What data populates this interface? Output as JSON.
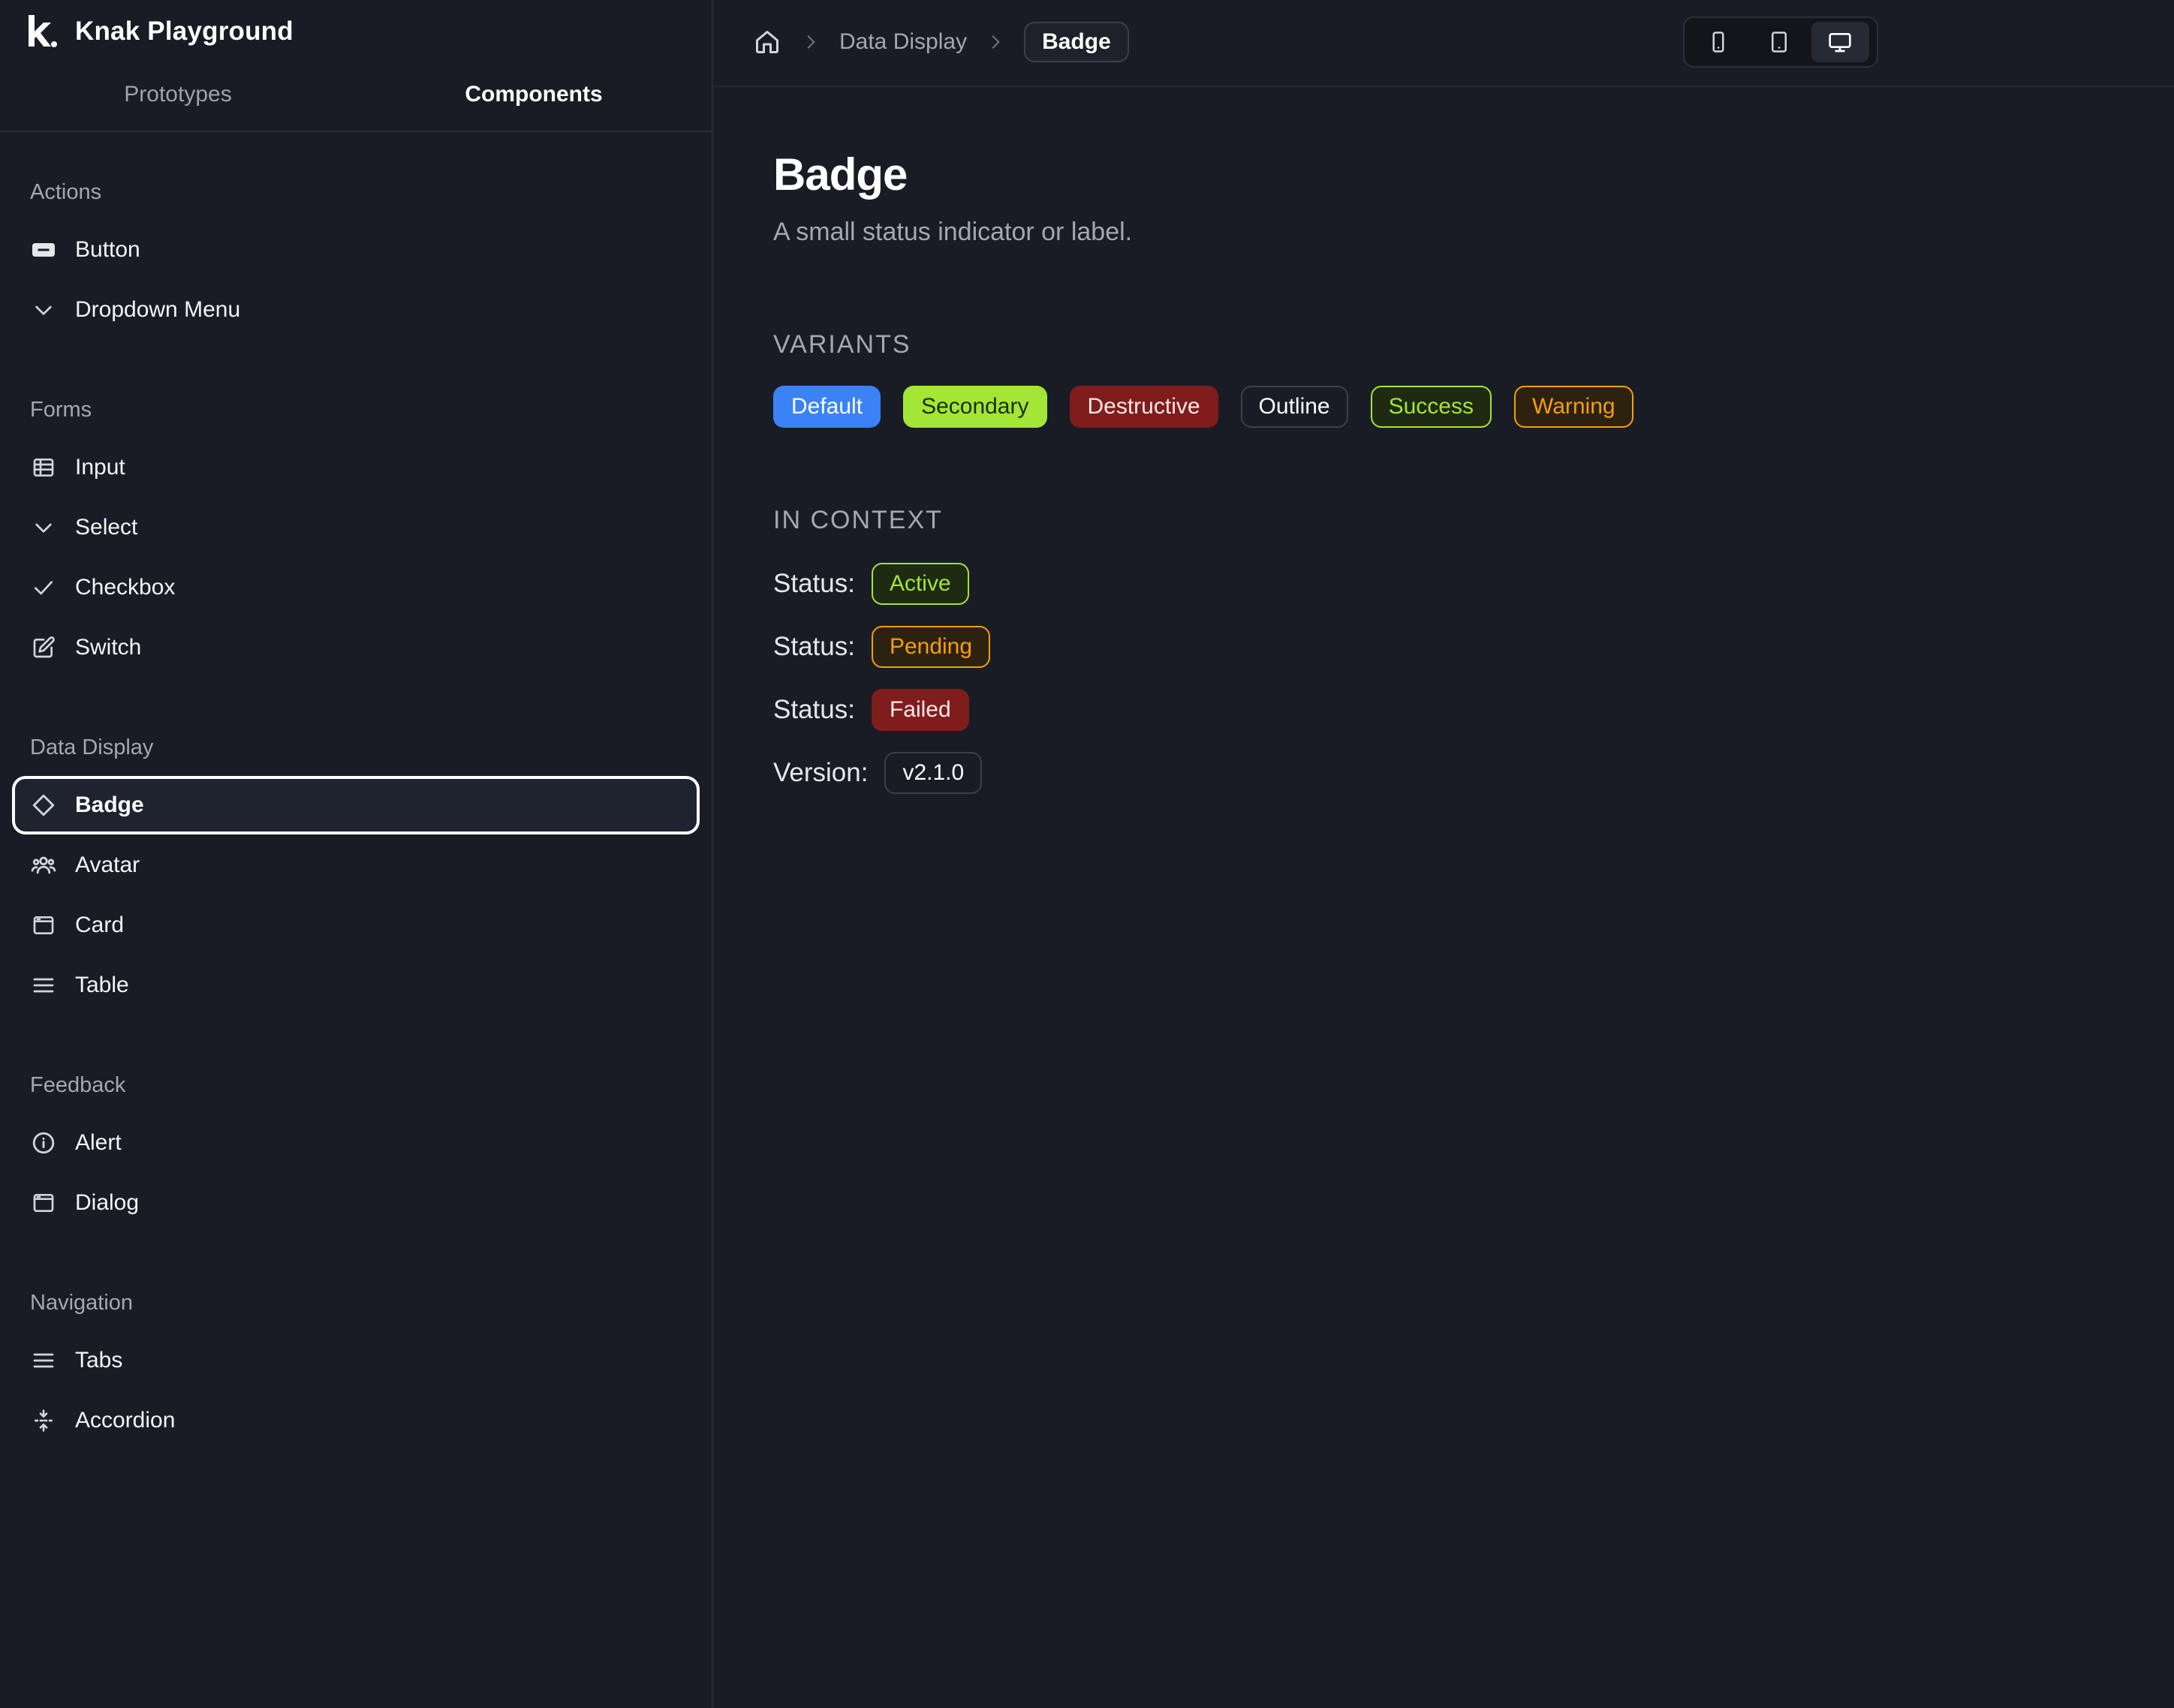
{
  "app": {
    "title": "Knak Playground"
  },
  "top_tabs": [
    {
      "label": "Prototypes",
      "active": false
    },
    {
      "label": "Components",
      "active": true
    }
  ],
  "sidebar": {
    "sections": [
      {
        "title": "Actions",
        "items": [
          {
            "label": "Button",
            "icon": "button-icon"
          },
          {
            "label": "Dropdown Menu",
            "icon": "chevron-down-icon"
          }
        ]
      },
      {
        "title": "Forms",
        "items": [
          {
            "label": "Input",
            "icon": "table-grid-icon"
          },
          {
            "label": "Select",
            "icon": "chevron-down-icon"
          },
          {
            "label": "Checkbox",
            "icon": "check-icon"
          },
          {
            "label": "Switch",
            "icon": "edit-icon"
          }
        ]
      },
      {
        "title": "Data Display",
        "items": [
          {
            "label": "Badge",
            "icon": "diamond-icon",
            "selected": true
          },
          {
            "label": "Avatar",
            "icon": "users-icon"
          },
          {
            "label": "Card",
            "icon": "window-icon"
          },
          {
            "label": "Table",
            "icon": "list-icon"
          }
        ]
      },
      {
        "title": "Feedback",
        "items": [
          {
            "label": "Alert",
            "icon": "info-icon"
          },
          {
            "label": "Dialog",
            "icon": "window-icon"
          }
        ]
      },
      {
        "title": "Navigation",
        "items": [
          {
            "label": "Tabs",
            "icon": "list-icon"
          },
          {
            "label": "Accordion",
            "icon": "fold-vertical-icon"
          }
        ]
      }
    ]
  },
  "breadcrumb": {
    "section": "Data Display",
    "current": "Badge"
  },
  "device_toggle": [
    {
      "name": "mobile",
      "active": false
    },
    {
      "name": "tablet",
      "active": false
    },
    {
      "name": "desktop",
      "active": true
    }
  ],
  "page": {
    "title": "Badge",
    "description": "A small status indicator or label.",
    "variants_label": "VARIANTS",
    "variants": [
      "Default",
      "Secondary",
      "Destructive",
      "Outline",
      "Success",
      "Warning"
    ],
    "context_label": "IN CONTEXT",
    "context": [
      {
        "label": "Status:",
        "badge": "Active",
        "variant": "success"
      },
      {
        "label": "Status:",
        "badge": "Pending",
        "variant": "warning"
      },
      {
        "label": "Status:",
        "badge": "Failed",
        "variant": "destructive"
      },
      {
        "label": "Version:",
        "badge": "v2.1.0",
        "variant": "outline"
      }
    ]
  },
  "colors": {
    "background": "#191c24",
    "default": "#3b82f6",
    "secondary": "#a3e635",
    "destructive": "#7f1d1d",
    "success": "#a3e635",
    "warning": "#f59e0b"
  }
}
